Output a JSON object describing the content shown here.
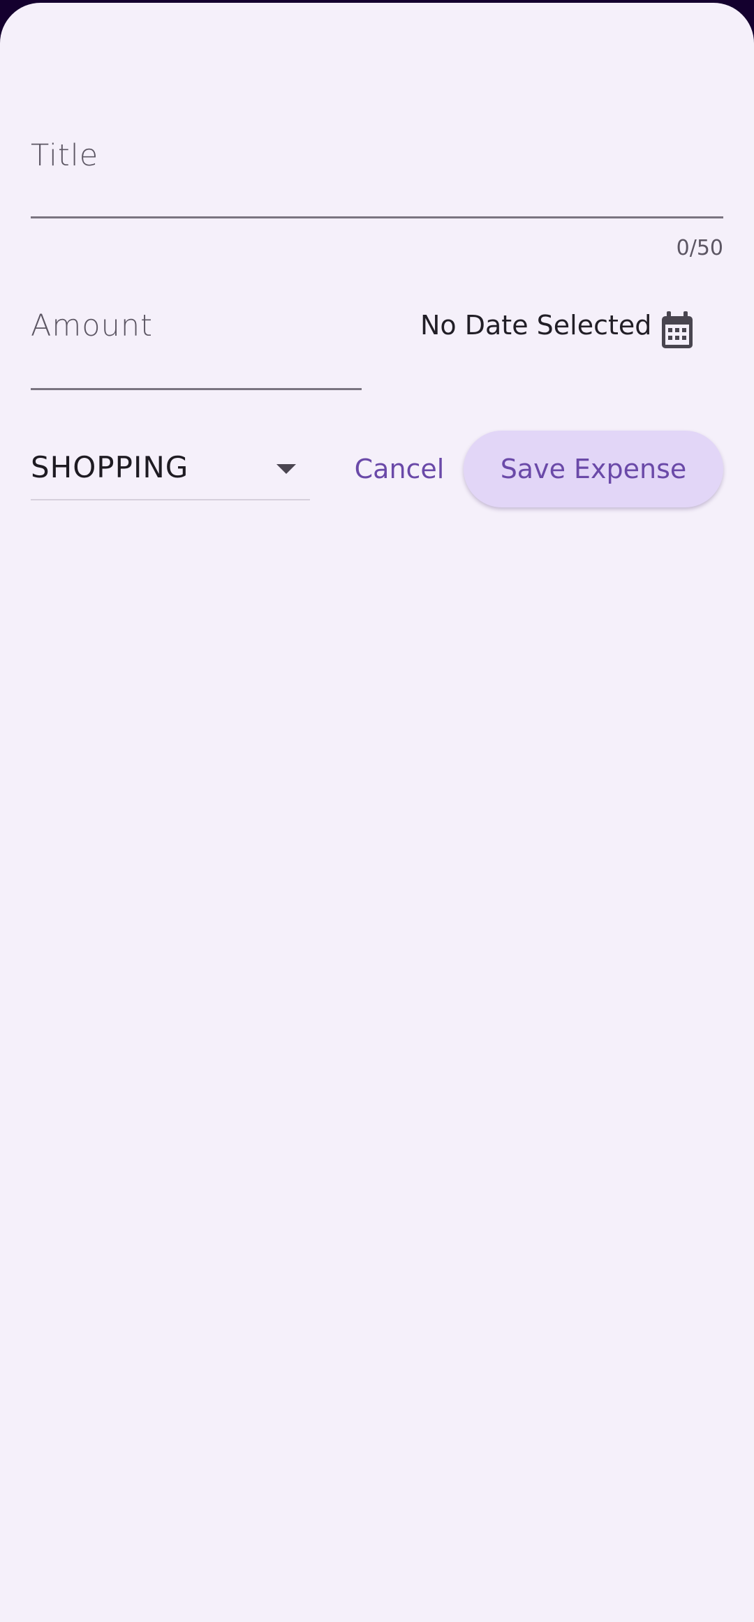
{
  "form": {
    "title_label": "Title",
    "title_counter": "0/50",
    "amount_label": "Amount",
    "date_text": "No Date Selected",
    "date_icon": "calendar-icon",
    "category_value": "SHOPPING",
    "cancel_label": "Cancel",
    "save_label": "Save Expense"
  },
  "colors": {
    "accent": "#6a49a8",
    "sheet_background": "#f5f0fa",
    "save_button_background": "#e2d6f7"
  }
}
